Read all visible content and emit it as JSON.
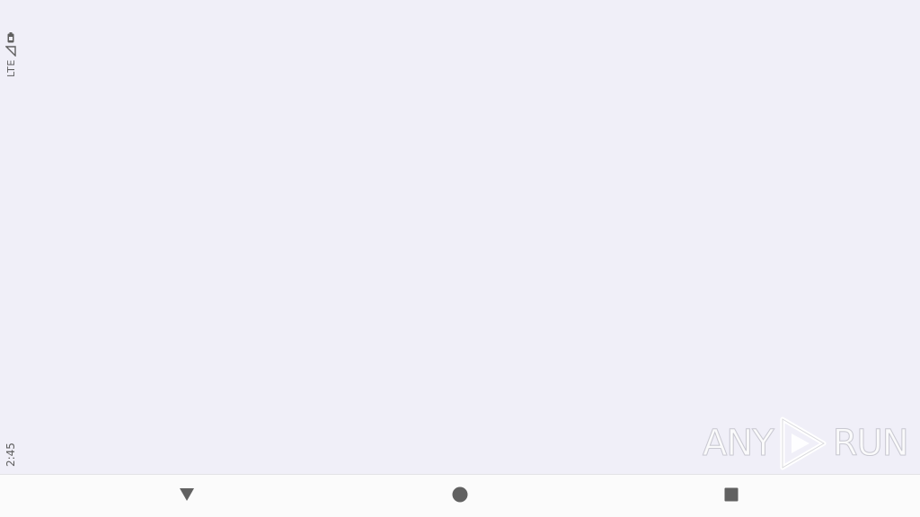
{
  "status_bar": {
    "network": "LTE",
    "time": "2:45",
    "icons": [
      "signal-icon",
      "battery-icon"
    ]
  },
  "watermark": {
    "text_left": "ANY",
    "text_right": "RUN",
    "icon": "play-logo-icon"
  },
  "navigation_bar": {
    "buttons": [
      "back-icon",
      "home-icon",
      "recents-icon"
    ]
  },
  "colors": {
    "background": "#f0eff8",
    "status_text": "#5f5f5f",
    "nav_bar": "#fbfbfb",
    "nav_icon": "#616161"
  }
}
